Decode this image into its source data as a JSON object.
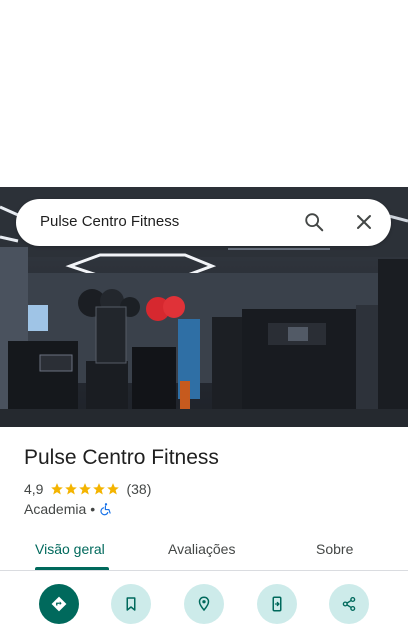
{
  "search": {
    "value": "Pulse Centro Fitness"
  },
  "place": {
    "name": "Pulse Centro Fitness",
    "rating": "4,9",
    "stars": 5,
    "review_count": "(38)",
    "category": "Academia",
    "separator": "•"
  },
  "tabs": [
    {
      "label": "Visão geral",
      "active": true
    },
    {
      "label": "Avaliações",
      "active": false
    },
    {
      "label": "Sobre",
      "active": false
    }
  ],
  "actions": [
    {
      "icon": "directions-icon"
    },
    {
      "icon": "bookmark-icon"
    },
    {
      "icon": "nearby-icon"
    },
    {
      "icon": "send-to-phone-icon"
    },
    {
      "icon": "share-icon"
    }
  ],
  "colors": {
    "accent": "#00695c",
    "action_bg": "#cdebea",
    "star": "#f4b400",
    "wheelchair": "#1a73e8"
  }
}
